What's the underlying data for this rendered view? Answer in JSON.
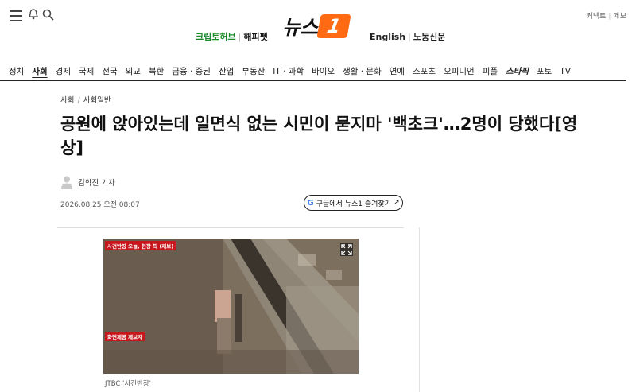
{
  "header": {
    "left_links": [
      "크립토허브",
      "해피펫"
    ],
    "right_links": [
      "English",
      "노동신문"
    ],
    "logo_text": "뉴스",
    "logo_badge": "1",
    "top_right": [
      "커넥트",
      "제보"
    ]
  },
  "categories": [
    "정치",
    "사회",
    "경제",
    "국제",
    "전국",
    "외교",
    "북한",
    "금융 · 증권",
    "산업",
    "부동산",
    "IT · 과학",
    "바이오",
    "생활 · 문화",
    "연예",
    "스포츠",
    "오피니언",
    "피플",
    "스타픽",
    "포토",
    "TV"
  ],
  "active_category": "사회",
  "breadcrumb": [
    "사회",
    "사회일반"
  ],
  "article": {
    "headline": "공원에 앉아있는데 일면식 없는 시민이 묻지마 '백초크'…2명이 당했다[영상]",
    "author": "김학진 기자",
    "date": "2026.08.25 오전 08:07",
    "google_button": "구글에서 뉴스1 즐겨찾기"
  },
  "media": {
    "caption_top": "사건반장 오늘, 현장 픽 (제보)",
    "caption_bottom": "화면제공 제보자",
    "credit": "JTBC '사건반장'"
  },
  "colors": {
    "brand_orange": "#ff6a13",
    "green_link": "#1a8a2a",
    "caption_red": "#c8161d"
  }
}
